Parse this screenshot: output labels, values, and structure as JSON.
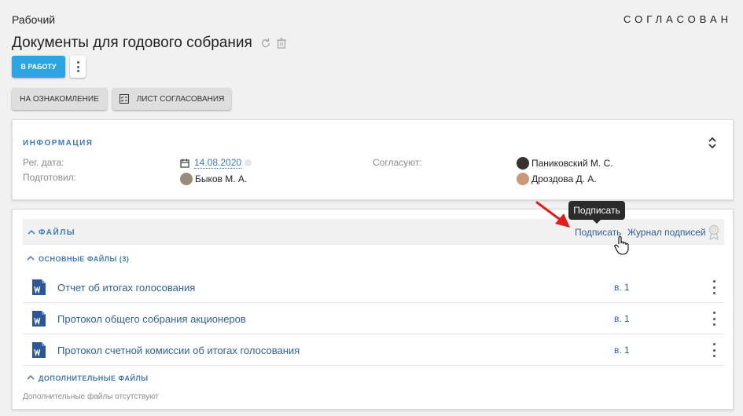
{
  "header": {
    "breadcrumb": "Рабочий",
    "status": "СОГЛАСОВАН",
    "title": "Документы для годового собрания"
  },
  "actions": {
    "primary_label": "В РАБОТУ",
    "ack_label": "НА ОЗНАКОМЛЕНИЕ",
    "sheet_label": "ЛИСТ СОГЛАСОВАНИЯ"
  },
  "info": {
    "title": "ИНФОРМАЦИЯ",
    "reg_date_label": "Рег. дата:",
    "reg_date_value": "14.08.2020",
    "prepared_label": "Подготовил:",
    "prepared_value": "Быков М. А.",
    "approvers_label": "Согласуют:",
    "approvers": [
      "Паниковский М. С.",
      "Дроздова Д. А."
    ]
  },
  "files": {
    "title": "ФАЙЛЫ",
    "sign_link": "Подписать",
    "journal_link": "Журнал подписей",
    "main_title": "ОСНОВНЫЕ ФАЙЛЫ (3)",
    "items": [
      {
        "name": "Отчет об итогах голосования",
        "version": "в. 1"
      },
      {
        "name": "Протокол общего собрания акционеров",
        "version": "в. 1"
      },
      {
        "name": "Протокол счетной комиссии об итогах голосования",
        "version": "в. 1"
      }
    ],
    "extra_title": "ДОПОЛНИТЕЛЬНЫЕ ФАЙЛЫ",
    "extra_empty": "Дополнительные файлы отсутствуют"
  },
  "tooltip": {
    "text": "Подписать"
  },
  "colors": {
    "accent": "#2aa4e3",
    "link": "#2f5f96",
    "section": "#4078b4",
    "word": "#2b5797",
    "arrow": "#e21b1b"
  }
}
